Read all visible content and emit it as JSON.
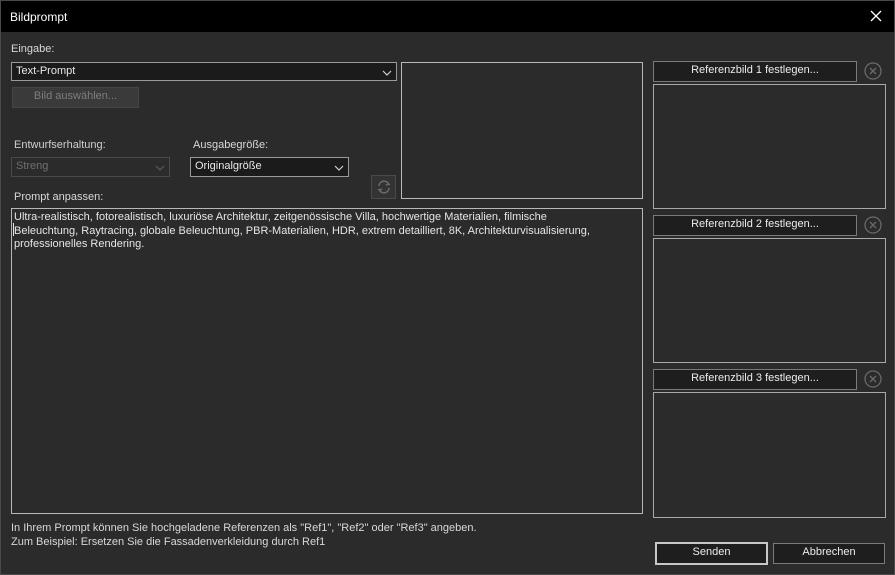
{
  "window": {
    "title": "Bildprompt"
  },
  "input": {
    "label": "Eingabe:",
    "selected": "Text-Prompt",
    "select_image_label": "Bild auswählen..."
  },
  "design_retention": {
    "label": "Entwurfserhaltung:",
    "selected": "Streng"
  },
  "output_size": {
    "label": "Ausgabegröße:",
    "selected": "Originalgröße"
  },
  "prompt": {
    "label": "Prompt anpassen:",
    "text": "Ultra-realistisch, fotorealistisch, luxuriöse Architektur, zeitgenössische Villa, hochwertige Materialien, filmische\nBeleuchtung, Raytracing, globale Beleuchtung, PBR-Materialien, HDR, extrem detailliert, 8K, Architekturvisualisierung,\nprofessionelles Rendering."
  },
  "references": [
    {
      "button_label": "Referenzbild 1 festlegen..."
    },
    {
      "button_label": "Referenzbild 2 festlegen..."
    },
    {
      "button_label": "Referenzbild 3 festlegen..."
    }
  ],
  "hint": {
    "line1": "In Ihrem Prompt können Sie hochgeladene Referenzen als \"Ref1\", \"Ref2\" oder \"Ref3\" angeben.",
    "line2": "Zum Beispiel: Ersetzen Sie die Fassadenverkleidung durch Ref1"
  },
  "actions": {
    "send_label": "Senden",
    "cancel_label": "Abbrechen"
  },
  "icons": {
    "close": "close-icon",
    "dropdown": "chevron-down-icon",
    "refresh": "refresh-icon",
    "remove": "remove-circle-icon"
  }
}
